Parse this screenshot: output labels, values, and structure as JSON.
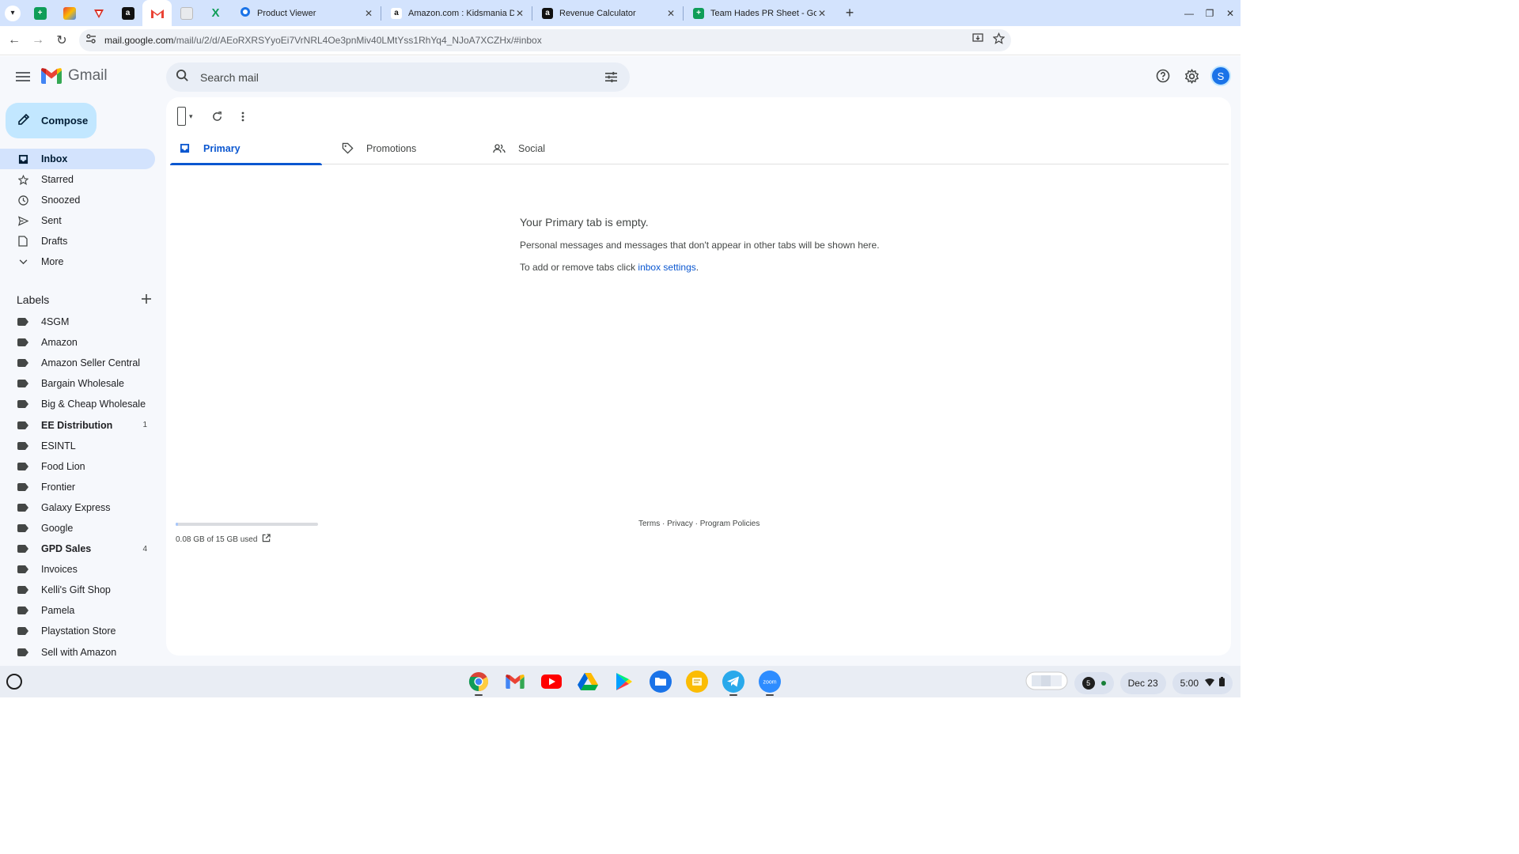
{
  "browser": {
    "tabs": [
      {
        "title": "Product Viewer",
        "icon": "product-viewer-icon"
      },
      {
        "title": "Amazon.com : Kidsmania Dub",
        "icon": "amazon-icon"
      },
      {
        "title": "Revenue Calculator",
        "icon": "amazon-icon"
      },
      {
        "title": "Team Hades PR Sheet - Google",
        "icon": "sheets-icon"
      }
    ],
    "close_glyph": "✕",
    "new_tab_glyph": "+",
    "url_host": "mail.google.com",
    "url_path": "/mail/u/2/d/AEoRXRSYyoEi7VrNRL4Oe3pnMiv40LMtYss1RhYq4_NJoA7XCZHx/#inbox"
  },
  "gmail": {
    "logo_text": "Gmail",
    "search_placeholder": "Search mail",
    "avatar_initial": "S",
    "compose_label": "Compose",
    "nav": [
      {
        "label": "Inbox",
        "icon": "inbox-icon",
        "active": true
      },
      {
        "label": "Starred",
        "icon": "star-icon"
      },
      {
        "label": "Snoozed",
        "icon": "clock-icon"
      },
      {
        "label": "Sent",
        "icon": "send-icon"
      },
      {
        "label": "Drafts",
        "icon": "draft-icon"
      },
      {
        "label": "More",
        "icon": "chevron-down-icon"
      }
    ],
    "labels_heading": "Labels",
    "labels": [
      {
        "name": "4SGM",
        "count": ""
      },
      {
        "name": "Amazon",
        "count": ""
      },
      {
        "name": "Amazon Seller Central",
        "count": ""
      },
      {
        "name": "Bargain Wholesale",
        "count": ""
      },
      {
        "name": "Big & Cheap Wholesale",
        "count": ""
      },
      {
        "name": "EE Distribution",
        "count": "1"
      },
      {
        "name": "ESINTL",
        "count": ""
      },
      {
        "name": "Food Lion",
        "count": ""
      },
      {
        "name": "Frontier",
        "count": ""
      },
      {
        "name": "Galaxy Express",
        "count": ""
      },
      {
        "name": "Google",
        "count": ""
      },
      {
        "name": "GPD Sales",
        "count": "4"
      },
      {
        "name": "Invoices",
        "count": ""
      },
      {
        "name": "Kelli's Gift Shop",
        "count": ""
      },
      {
        "name": "Pamela",
        "count": ""
      },
      {
        "name": "Playstation Store",
        "count": ""
      },
      {
        "name": "Sell with Amazon",
        "count": ""
      }
    ],
    "category_tabs": [
      {
        "label": "Primary",
        "active": true
      },
      {
        "label": "Promotions"
      },
      {
        "label": "Social"
      }
    ],
    "empty_title": "Your Primary tab is empty.",
    "empty_sub": "Personal messages and messages that don't appear in other tabs will be shown here.",
    "empty_link_prefix": "To add or remove tabs click ",
    "empty_link_text": "inbox settings",
    "empty_link_suffix": ".",
    "storage_text": "0.08 GB of 15 GB used",
    "storage_used_fraction": 0.0053,
    "footer_links": "Terms · Privacy · Program Policies"
  },
  "shelf": {
    "notification_count": "5",
    "date": "Dec 23",
    "time": "5:00"
  },
  "colors": {
    "accent": "#0b57d0",
    "compose_bg": "#c2e7ff",
    "active_nav": "#d3e3fd"
  }
}
